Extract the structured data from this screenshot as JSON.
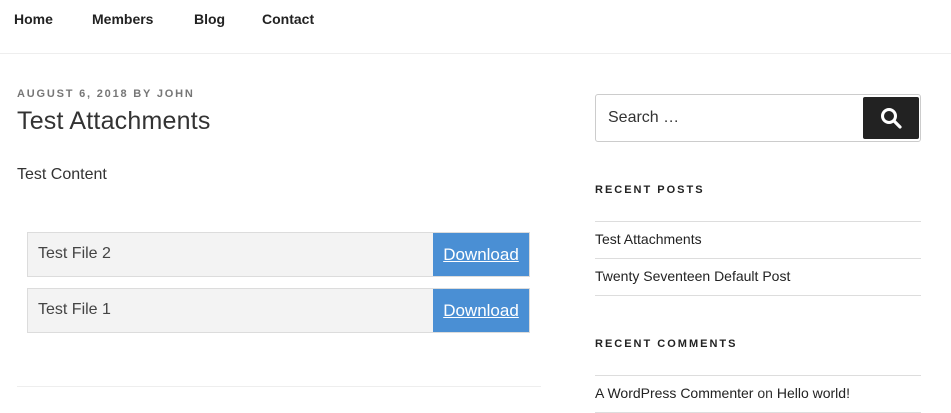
{
  "nav": {
    "items": [
      {
        "label": "Home"
      },
      {
        "label": "Members"
      },
      {
        "label": "Blog"
      },
      {
        "label": "Contact"
      }
    ]
  },
  "post": {
    "date": "August 6, 2018",
    "by": "by",
    "author": "John",
    "title": "Test Attachments",
    "content": "Test Content",
    "attachments": [
      {
        "name": "Test File 2",
        "button": "Download"
      },
      {
        "name": "Test File 1",
        "button": "Download"
      }
    ]
  },
  "sidebar": {
    "search": {
      "placeholder": "Search …",
      "button_icon": "search-icon"
    },
    "recent_posts": {
      "title": "Recent Posts",
      "items": [
        {
          "label": "Test Attachments"
        },
        {
          "label": "Twenty Seventeen Default Post"
        }
      ]
    },
    "recent_comments": {
      "title": "Recent Comments",
      "items": [
        {
          "author": "A WordPress Commenter",
          "on": "on",
          "post": "Hello world!"
        }
      ]
    }
  },
  "colors": {
    "download_button": "#4a8fd4",
    "search_button": "#222222",
    "attachment_row": "#f3f3f3"
  }
}
